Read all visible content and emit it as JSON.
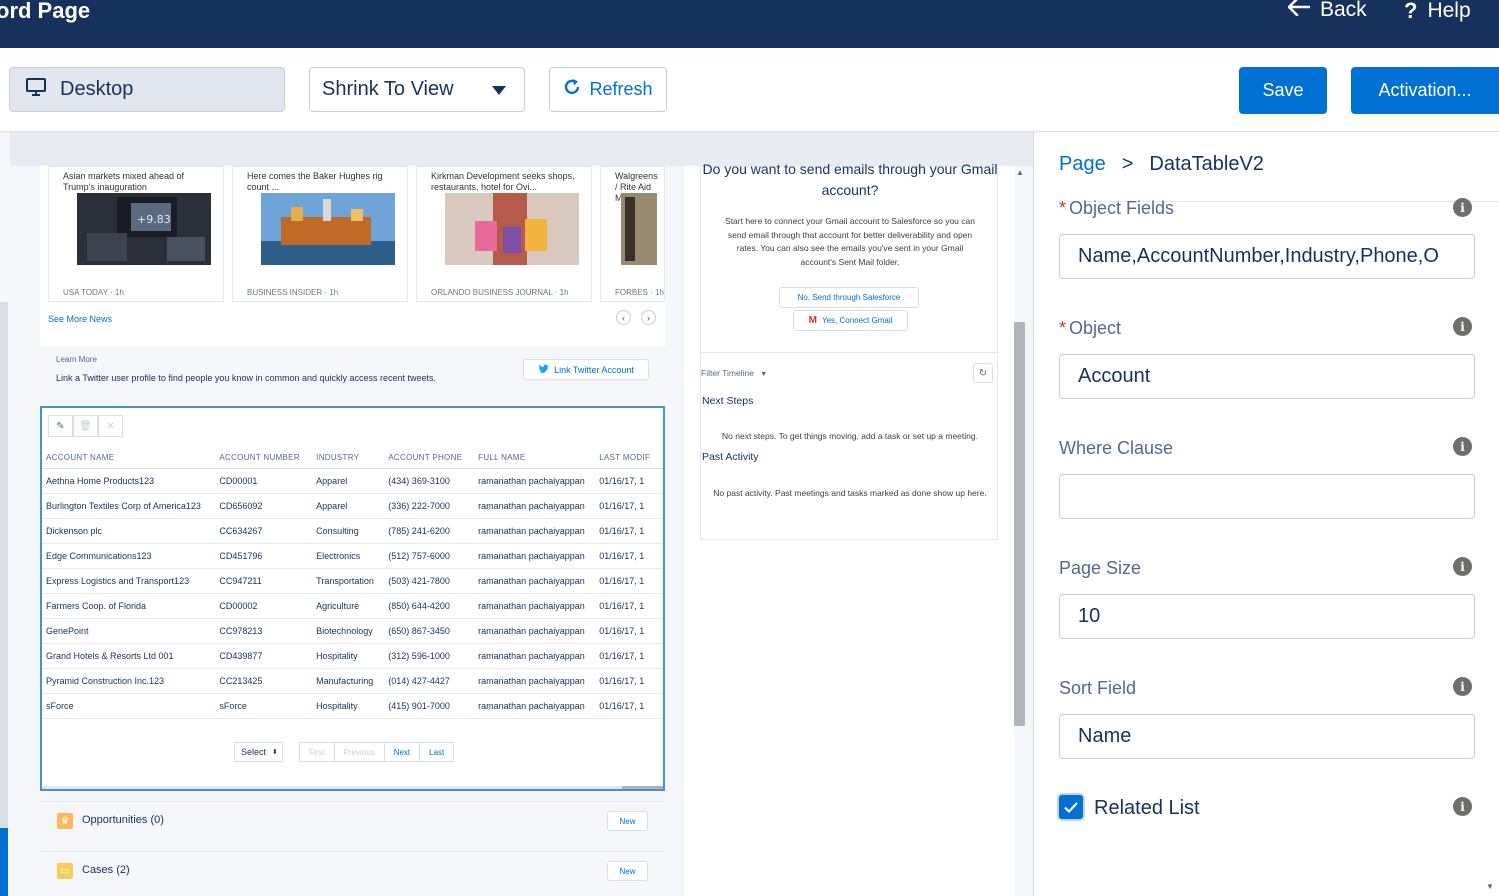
{
  "topbar": {
    "title": "ord Page",
    "back_label": "Back",
    "help_label": "Help"
  },
  "toolbar": {
    "desktop_label": "Desktop",
    "view_select": "Shrink To View",
    "refresh_label": "Refresh",
    "save_label": "Save",
    "activation_label": "Activation..."
  },
  "news": {
    "cards": [
      {
        "headline": "Asian markets mixed ahead of Trump's inauguration",
        "source": "USA TODAY · 1h"
      },
      {
        "headline": "Here comes the Baker Hughes rig count ...",
        "source": "BUSINESS INSIDER · 1h"
      },
      {
        "headline": "Kirkman Development seeks shops, restaurants, hotel for Ovi...",
        "source": "ORLANDO BUSINESS JOURNAL · 1h"
      },
      {
        "headline": "Walgreens / Rite Aid Me",
        "source": "FORBES · 1h"
      }
    ],
    "see_more": "See More News",
    "prev_icon": "‹",
    "next_icon": "›"
  },
  "twitter": {
    "learn_more": "Learn More",
    "description": "Link a Twitter user profile to find people you know in common and quickly access recent tweets.",
    "button": "Link Twitter Account"
  },
  "datatable": {
    "columns": [
      "ACCOUNT NAME",
      "ACCOUNT NUMBER",
      "INDUSTRY",
      "ACCOUNT PHONE",
      "FULL NAME",
      "LAST MODIF"
    ],
    "rows": [
      [
        "Aethna Home Products123",
        "CD00001",
        "Apparel",
        "(434) 369-3100",
        "ramanathan pachaiyappan",
        "01/16/17, 1"
      ],
      [
        "Burlington Textiles Corp of America123",
        "CD656092",
        "Apparel",
        "(336) 222-7000",
        "ramanathan pachaiyappan",
        "01/16/17, 1"
      ],
      [
        "Dickenson plc",
        "CC634267",
        "Consulting",
        "(785) 241-6200",
        "ramanathan pachaiyappan",
        "01/16/17, 1"
      ],
      [
        "Edge Communications123",
        "CD451796",
        "Electronics",
        "(512) 757-6000",
        "ramanathan pachaiyappan",
        "01/16/17, 1"
      ],
      [
        "Express Logistics and Transport123",
        "CC947211",
        "Transportation",
        "(503) 421-7800",
        "ramanathan pachaiyappan",
        "01/16/17, 1"
      ],
      [
        "Farmers Coop. of Florida",
        "CD00002",
        "Agriculture",
        "(850) 644-4200",
        "ramanathan pachaiyappan",
        "01/16/17, 1"
      ],
      [
        "GenePoint",
        "CC978213",
        "Biotechnology",
        "(650) 867-3450",
        "ramanathan pachaiyappan",
        "01/16/17, 1"
      ],
      [
        "Grand Hotels & Resorts Ltd 001",
        "CD439877",
        "Hospitality",
        "(312) 596-1000",
        "ramanathan pachaiyappan",
        "01/16/17, 1"
      ],
      [
        "Pyramid Construction Inc.123",
        "CC213425",
        "Manufacturing",
        "(014) 427-4427",
        "ramanathan pachaiyappan",
        "01/16/17, 1"
      ],
      [
        "sForce",
        "sForce",
        "Hospitality",
        "(415) 901-7000",
        "ramanathan pachaiyappan",
        "01/16/17, 1"
      ]
    ],
    "pager": {
      "select": "Select",
      "first": "First",
      "previous": "Previous",
      "next": "Next",
      "last": "Last"
    }
  },
  "related": [
    {
      "label": "Opportunities (0)",
      "new": "New",
      "color": "#fcb95b"
    },
    {
      "label": "Cases (2)",
      "new": "New",
      "color": "#f2cf5b"
    }
  ],
  "gmail": {
    "question": "Do you want to send emails through your Gmail account?",
    "paragraph": "Start here to connect your Gmail account to Salesforce so you can send email through that account for better deliverability and open rates. You can also see the emails you've sent in your Gmail account's Sent Mail folder.",
    "btn_salesforce": "No, Send through Salesforce",
    "btn_gmail": "Yes, Connect Gmail",
    "filter": "Filter Timeline",
    "next_steps": "Next Steps",
    "next_steps_desc": "No next steps. To get things moving, add a task or set up a meeting.",
    "past_activity": "Past Activity",
    "past_activity_desc": "No past activity. Past meetings and tasks marked as done show up here."
  },
  "properties": {
    "breadcrumb_root": "Page",
    "breadcrumb_sep": ">",
    "breadcrumb_current": "DataTableV2",
    "object_fields_label": "Object Fields",
    "object_fields_value": "Name,AccountNumber,Industry,Phone,O",
    "object_label": "Object",
    "object_value": "Account",
    "where_label": "Where Clause",
    "where_value": "",
    "page_size_label": "Page Size",
    "page_size_value": "10",
    "sort_label": "Sort Field",
    "sort_value": "Name",
    "related_list_label": "Related List",
    "related_list_checked": true
  },
  "colors": {
    "header_bg": "#16325c",
    "brand": "#0070d2",
    "required": "#c23934"
  }
}
